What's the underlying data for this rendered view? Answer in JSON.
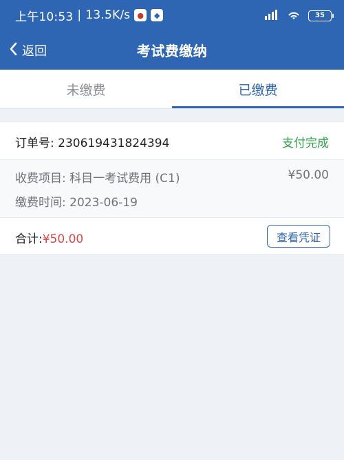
{
  "status_bar": {
    "time": "上午10:53",
    "separator": "|",
    "network_speed": "13.5K/s",
    "battery_level": "35",
    "icons": [
      "notification-red-icon",
      "notification-baidu-icon",
      "hd-signal-icon",
      "wifi-icon",
      "battery-icon"
    ]
  },
  "nav": {
    "back_label": "返回",
    "title": "考试费缴纳"
  },
  "tabs": [
    {
      "label": "未缴费",
      "active": false
    },
    {
      "label": "已缴费",
      "active": true
    }
  ],
  "order": {
    "order_number_label": "订单号: 230619431824394",
    "status": "支付完成",
    "item_label": "收费项目: 科目一考试费用 (C1)",
    "item_price": "¥50.00",
    "time_label": "缴费时间: 2023-06-19",
    "total_prefix": "合计:",
    "total_amount": "¥50.00",
    "voucher_button": "查看凭证"
  },
  "colors": {
    "primary": "#2f66b3",
    "success": "#2ea34a",
    "price_red": "#d34b4b",
    "background": "#eef2f6"
  }
}
